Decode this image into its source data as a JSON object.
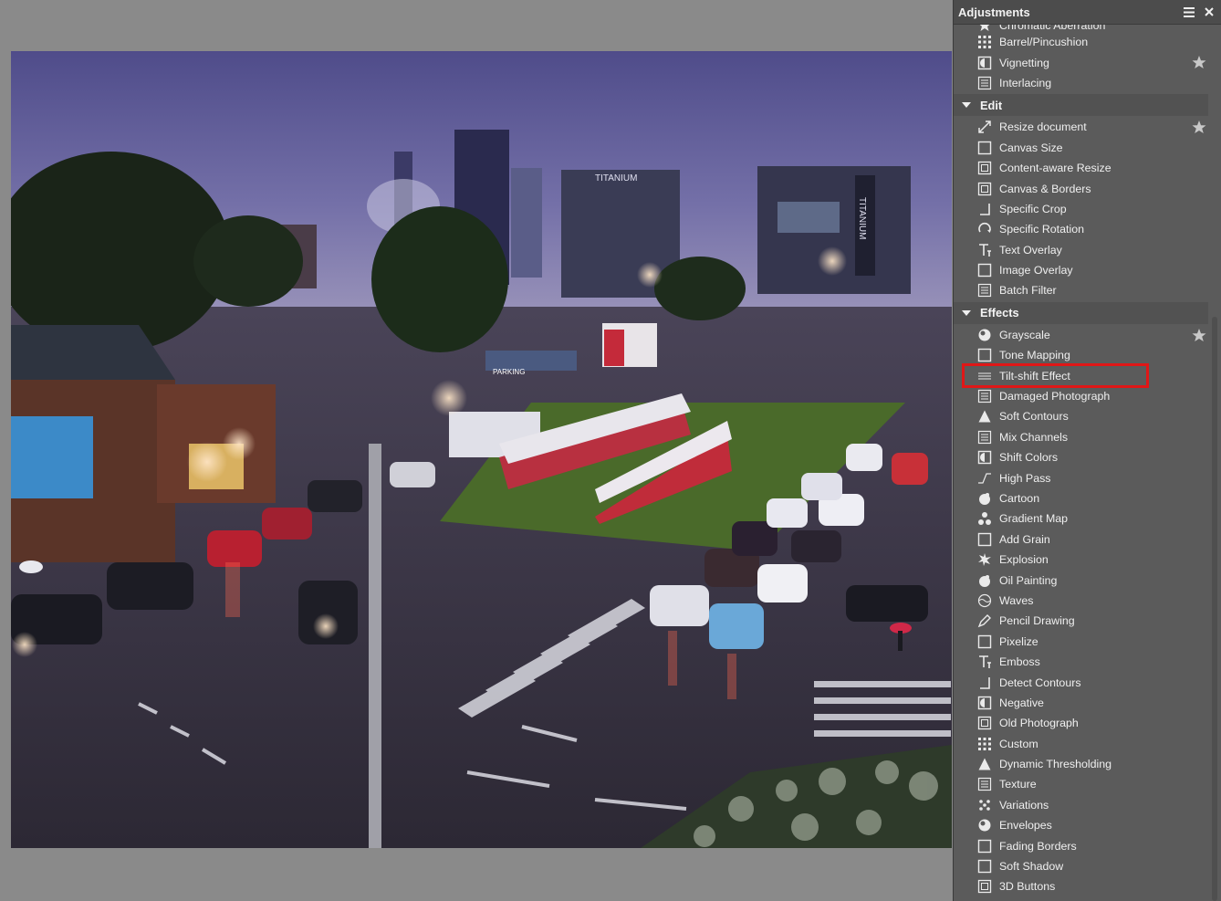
{
  "panel": {
    "title": "Adjustments",
    "menu_icon": "hamburger-menu-icon",
    "close_icon": "close-icon",
    "partial_item": {
      "label": "Chromatic Aberration",
      "icon": "chromatic-icon"
    },
    "groups_top": [
      {
        "label": "Barrel/Pincushion",
        "icon": "barrel-icon"
      },
      {
        "label": "Vignetting",
        "icon": "vignetting-icon",
        "starred": true
      },
      {
        "label": "Interlacing",
        "icon": "interlacing-icon"
      }
    ],
    "sections": [
      {
        "title": "Edit",
        "items": [
          {
            "label": "Resize document",
            "icon": "resize-icon",
            "starred": true
          },
          {
            "label": "Canvas Size",
            "icon": "canvas-size-icon"
          },
          {
            "label": "Content-aware Resize",
            "icon": "content-aware-icon"
          },
          {
            "label": "Canvas & Borders",
            "icon": "borders-icon"
          },
          {
            "label": "Specific Crop",
            "icon": "crop-icon"
          },
          {
            "label": "Specific Rotation",
            "icon": "rotation-icon"
          },
          {
            "label": "Text Overlay",
            "icon": "text-icon"
          },
          {
            "label": "Image Overlay",
            "icon": "image-overlay-icon"
          },
          {
            "label": "Batch Filter",
            "icon": "batch-icon"
          }
        ]
      },
      {
        "title": "Effects",
        "items": [
          {
            "label": "Grayscale",
            "icon": "grayscale-icon",
            "starred": true
          },
          {
            "label": "Tone Mapping",
            "icon": "tone-mapping-icon"
          },
          {
            "label": "Tilt-shift Effect",
            "icon": "tilt-shift-icon",
            "highlighted": true
          },
          {
            "label": "Damaged Photograph",
            "icon": "damaged-icon"
          },
          {
            "label": "Soft Contours",
            "icon": "soft-contours-icon"
          },
          {
            "label": "Mix Channels",
            "icon": "mix-channels-icon"
          },
          {
            "label": "Shift Colors",
            "icon": "shift-colors-icon"
          },
          {
            "label": "High Pass",
            "icon": "high-pass-icon"
          },
          {
            "label": "Cartoon",
            "icon": "cartoon-icon"
          },
          {
            "label": "Gradient Map",
            "icon": "gradient-map-icon"
          },
          {
            "label": "Add Grain",
            "icon": "grain-icon"
          },
          {
            "label": "Explosion",
            "icon": "explosion-icon"
          },
          {
            "label": "Oil Painting",
            "icon": "oil-painting-icon"
          },
          {
            "label": "Waves",
            "icon": "waves-icon"
          },
          {
            "label": "Pencil Drawing",
            "icon": "pencil-icon"
          },
          {
            "label": "Pixelize",
            "icon": "pixelize-icon"
          },
          {
            "label": "Emboss",
            "icon": "emboss-icon"
          },
          {
            "label": "Detect Contours",
            "icon": "detect-contours-icon"
          },
          {
            "label": "Negative",
            "icon": "negative-icon"
          },
          {
            "label": "Old Photograph",
            "icon": "old-photo-icon"
          },
          {
            "label": "Custom",
            "icon": "custom-icon"
          },
          {
            "label": "Dynamic Thresholding",
            "icon": "threshold-icon"
          },
          {
            "label": "Texture",
            "icon": "texture-icon"
          },
          {
            "label": "Variations",
            "icon": "variations-icon"
          },
          {
            "label": "Envelopes",
            "icon": "envelopes-icon"
          },
          {
            "label": "Fading Borders",
            "icon": "fading-borders-icon"
          },
          {
            "label": "Soft Shadow",
            "icon": "soft-shadow-icon"
          },
          {
            "label": "3D Buttons",
            "icon": "3d-buttons-icon"
          }
        ]
      }
    ]
  },
  "photo": {
    "signs": [
      "TITANIUM",
      "TITANIUM",
      "PARKING"
    ]
  },
  "colors": {
    "panel_bg": "#5b5b5b",
    "panel_header": "#4c4c4c",
    "section_bg": "#525252",
    "highlight": "#e01717",
    "workspace": "#8a8a8a"
  }
}
